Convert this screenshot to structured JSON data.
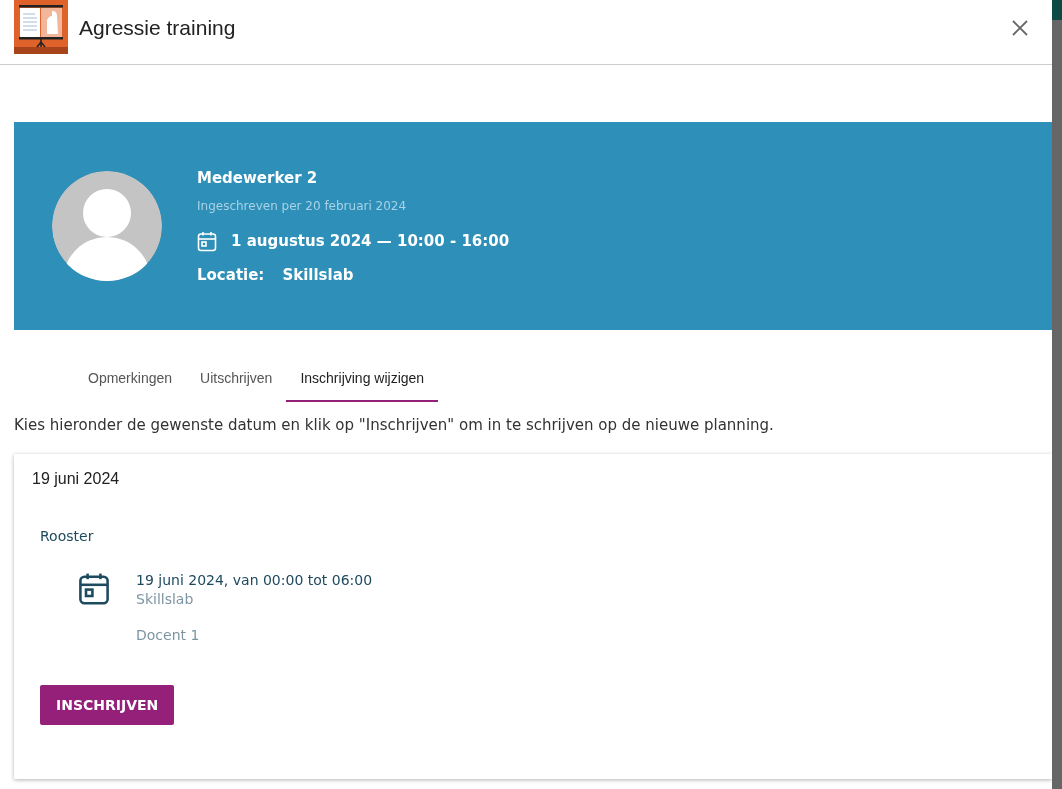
{
  "dialog": {
    "title": "Agressie training"
  },
  "registration": {
    "name": "Medewerker 2",
    "registered": "Ingeschreven per 20 februari 2024",
    "date": "1 augustus 2024 — 10:00 - 16:00",
    "location_label": "Locatie:",
    "location": "Skillslab"
  },
  "tabs": [
    {
      "label": "Opmerkingen",
      "selected": false
    },
    {
      "label": "Uitschrijven",
      "selected": false
    },
    {
      "label": "Inschrijving wijzigen",
      "selected": true
    }
  ],
  "instruction": "Kies hieronder de gewenste datum en klik op \"Inschrijven\" om in te schrijven op de nieuwe planning.",
  "option": {
    "title": "19 juni 2024",
    "section": "Rooster",
    "schedule": {
      "when": "19 juni 2024, van 00:00 tot 06:00",
      "location": "Skillslab",
      "teacher": "Docent 1"
    },
    "button": "INSCHRIJVEN"
  }
}
